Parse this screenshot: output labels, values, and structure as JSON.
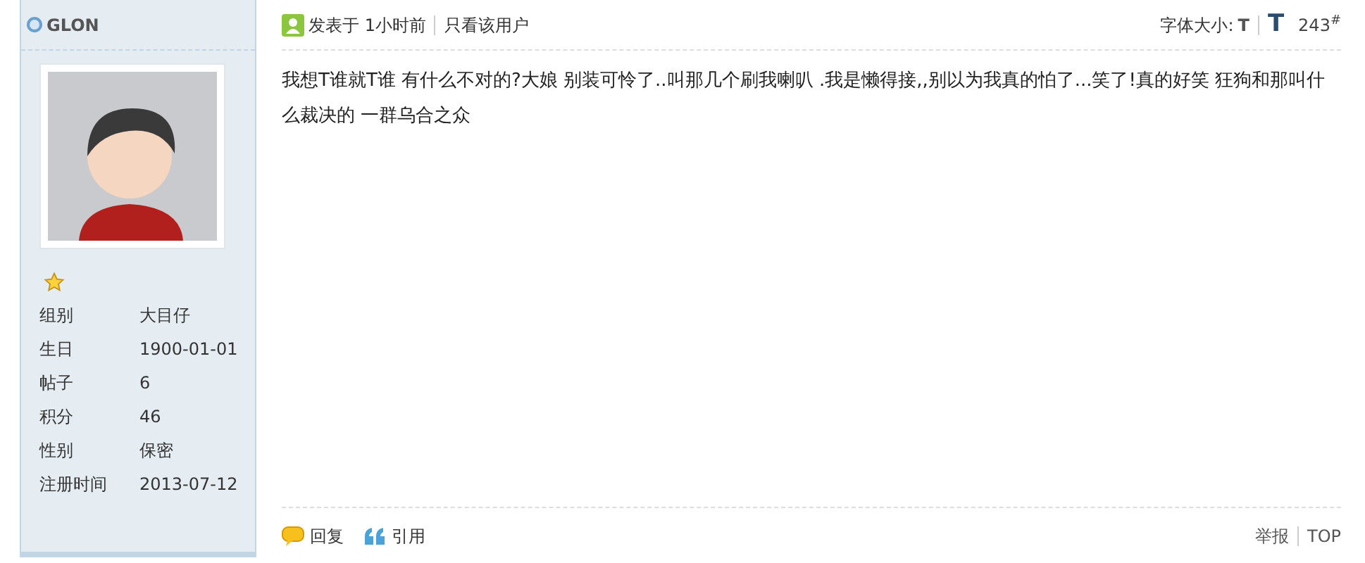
{
  "author": {
    "name": "GLON",
    "online": false
  },
  "profile": [
    {
      "label": "组别",
      "value": "大目仔"
    },
    {
      "label": "生日",
      "value": "1900-01-01"
    },
    {
      "label": "帖子",
      "value": "6"
    },
    {
      "label": "积分",
      "value": "46"
    },
    {
      "label": "性别",
      "value": "保密"
    },
    {
      "label": "注册时间",
      "value": "2013-07-12"
    }
  ],
  "post_header": {
    "posted": "发表于 1小时前",
    "only_author": "只看该用户",
    "font_size_label": "字体大小:",
    "font_small": "T",
    "font_large": "T",
    "floor": "243",
    "floor_mark": "#"
  },
  "content": "我想T谁就T谁  有什么不对的?大娘 别装可怜了..叫那几个刷我喇叭 .我是懒得接,,别以为我真的怕了...笑了!真的好笑   狂狗和那叫什么裁决的   一群乌合之众",
  "actions": [
    {
      "label": "回复",
      "kind": "reply"
    },
    {
      "label": "引用",
      "kind": "quote"
    }
  ],
  "tools": [
    "举报",
    "TOP"
  ]
}
